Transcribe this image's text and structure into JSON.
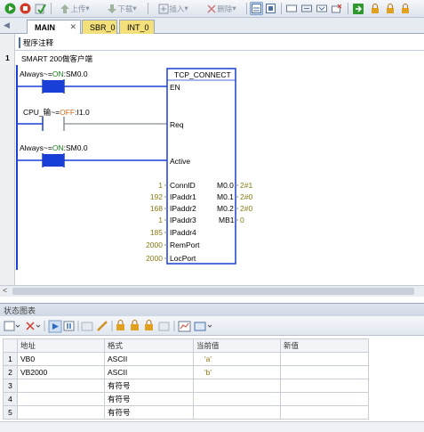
{
  "toolbar": {
    "upload_label": "上传",
    "download_label": "下载",
    "insert_label": "插入",
    "delete_label": "删除"
  },
  "tabs": [
    {
      "label": "MAIN"
    },
    {
      "label": "SBR_0"
    },
    {
      "label": "INT_0"
    }
  ],
  "editor": {
    "program_comment": "程序注释",
    "network_number": "1",
    "network_title": "SMART 200做客户端",
    "contacts": [
      {
        "name": "Always~",
        "state": "ON",
        "address": "SM0.0"
      },
      {
        "name": "CPU_输",
        "state": "OFF",
        "address": "I1.0"
      },
      {
        "name": "Always~",
        "state": "ON",
        "address": "SM0.0"
      }
    ],
    "eq_sign": "=",
    "tilde_eq": "~=",
    "block": {
      "title": "TCP_CONNECT",
      "en": "EN",
      "req": "Req",
      "active": "Active",
      "inputs": [
        {
          "value": "1",
          "pin": "ConnID"
        },
        {
          "value": "192",
          "pin": "IPaddr1"
        },
        {
          "value": "168",
          "pin": "IPaddr2"
        },
        {
          "value": "1",
          "pin": "IPaddr3"
        },
        {
          "value": "185",
          "pin": "IPaddr4"
        },
        {
          "value": "2000",
          "pin": "RemPort"
        },
        {
          "value": "2000",
          "pin": "LocPort"
        }
      ],
      "outputs": [
        {
          "address": "M0.0",
          "value": "2#1"
        },
        {
          "address": "M0.1",
          "value": "2#0"
        },
        {
          "address": "M0.2",
          "value": "2#0"
        },
        {
          "address": "MB1",
          "value": "0"
        }
      ]
    }
  },
  "status_chart": {
    "title": "状态图表",
    "columns": [
      "地址",
      "格式",
      "当前值",
      "新值"
    ],
    "rows": [
      {
        "num": "1",
        "address": "VB0",
        "format": "ASCII",
        "current": "'a'",
        "new": ""
      },
      {
        "num": "2",
        "address": "VB2000",
        "format": "ASCII",
        "current": "'b'",
        "new": ""
      },
      {
        "num": "3",
        "address": "",
        "format": "有符号",
        "current": "",
        "new": ""
      },
      {
        "num": "4",
        "address": "",
        "format": "有符号",
        "current": "",
        "new": ""
      },
      {
        "num": "5",
        "address": "",
        "format": "有符号",
        "current": "",
        "new": ""
      }
    ]
  },
  "colors": {
    "contact_on": "#1a3fd6",
    "energized_wire": "#1a3fd6",
    "unenergized_wire": "#8a8f96",
    "value_text": "#8a7a12",
    "on_text": "#1a8a1a",
    "off_text": "#d0681a",
    "tab_highlight": "#f4e07a"
  }
}
